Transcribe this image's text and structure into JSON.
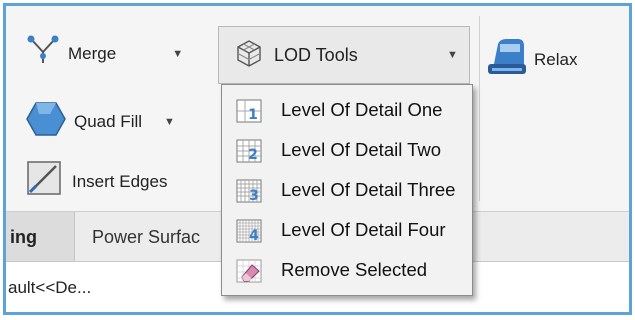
{
  "ribbon": {
    "merge_label": "Merge",
    "quad_fill_label": "Quad Fill",
    "insert_edges_label": "Insert Edges",
    "lod_tools_label": "LOD Tools",
    "relax_label": "Relax"
  },
  "lod_menu": {
    "items": [
      {
        "label": "Level Of Detail One",
        "icon": "lod-one-icon",
        "digit": "1"
      },
      {
        "label": "Level Of Detail Two",
        "icon": "lod-two-icon",
        "digit": "2"
      },
      {
        "label": "Level Of Detail Three",
        "icon": "lod-three-icon",
        "digit": "3"
      },
      {
        "label": "Level Of Detail Four",
        "icon": "lod-four-icon",
        "digit": "4"
      },
      {
        "label": "Remove Selected",
        "icon": "eraser-icon"
      }
    ]
  },
  "tabs": [
    {
      "label": "ing"
    },
    {
      "label": "Power Surfac"
    }
  ],
  "content": {
    "text": "ault<<De..."
  },
  "colors": {
    "frame_border": "#5ba3d8",
    "icon_blue": "#3a7fc8"
  }
}
